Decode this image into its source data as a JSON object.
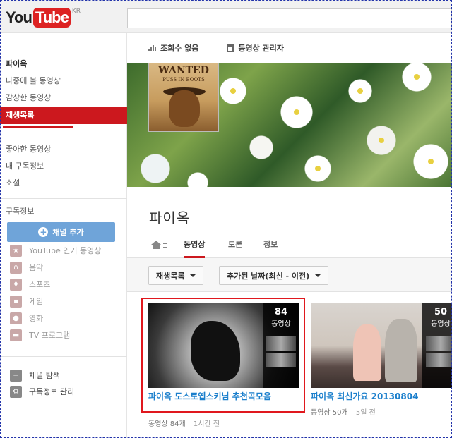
{
  "header": {
    "logo_you": "You",
    "logo_tube": "Tube",
    "logo_region": "KR",
    "search_placeholder": ""
  },
  "sidebar": {
    "nav": [
      {
        "label": "파이옥",
        "state": "bold"
      },
      {
        "label": "나중에 볼 동영상",
        "state": "normal"
      },
      {
        "label": "감상한 동영상",
        "state": "normal"
      },
      {
        "label": "재생목록",
        "state": "active"
      },
      {
        "label": "좋아한 동영상",
        "state": "normal"
      },
      {
        "label": "내 구독정보",
        "state": "normal"
      },
      {
        "label": "소셜",
        "state": "normal"
      }
    ],
    "subscriptions_title": "구독정보",
    "add_channel_label": "채널 추가",
    "subscriptions": [
      {
        "label": "YouTube 인기 동영상",
        "icon": "star-icon"
      },
      {
        "label": "음악",
        "icon": "headphones-icon"
      },
      {
        "label": "스포츠",
        "icon": "trophy-icon"
      },
      {
        "label": "게임",
        "icon": "gamepad-icon"
      },
      {
        "label": "영화",
        "icon": "film-reel-icon"
      },
      {
        "label": "TV 프로그램",
        "icon": "tv-icon"
      }
    ],
    "footer": [
      {
        "label": "채널 탐색",
        "icon": "plus-circle-icon"
      },
      {
        "label": "구독정보 관리",
        "icon": "gear-icon"
      }
    ]
  },
  "channel": {
    "views_label": "조회수 없음",
    "manager_label": "동영상 관리자",
    "title": "파이옥",
    "avatar_text": "WANTED",
    "avatar_subtext": "PUSS IN BOOTS",
    "tabs": [
      {
        "label": "동영상",
        "active": true
      },
      {
        "label": "토론",
        "active": false
      },
      {
        "label": "정보",
        "active": false
      }
    ],
    "filter_type": "재생목록",
    "filter_sort": "추가된 날짜(최신 - 이전)"
  },
  "playlists": [
    {
      "title": "파이옥 도스토옙스키님 추천곡모음",
      "count": "84",
      "count_label": "동영상",
      "meta_videos": "동영상 84개",
      "meta_time": "1시간 전"
    },
    {
      "title": "파이옥 최신가요 20130804",
      "count": "50",
      "count_label": "동영상",
      "meta_videos": "동영상 50개",
      "meta_time": "5일 전"
    }
  ],
  "colors": {
    "accent_red": "#cc181e",
    "link_blue": "#1b7fcc",
    "add_button_blue": "#6fa4d9",
    "highlight_box": "#e0181e"
  }
}
